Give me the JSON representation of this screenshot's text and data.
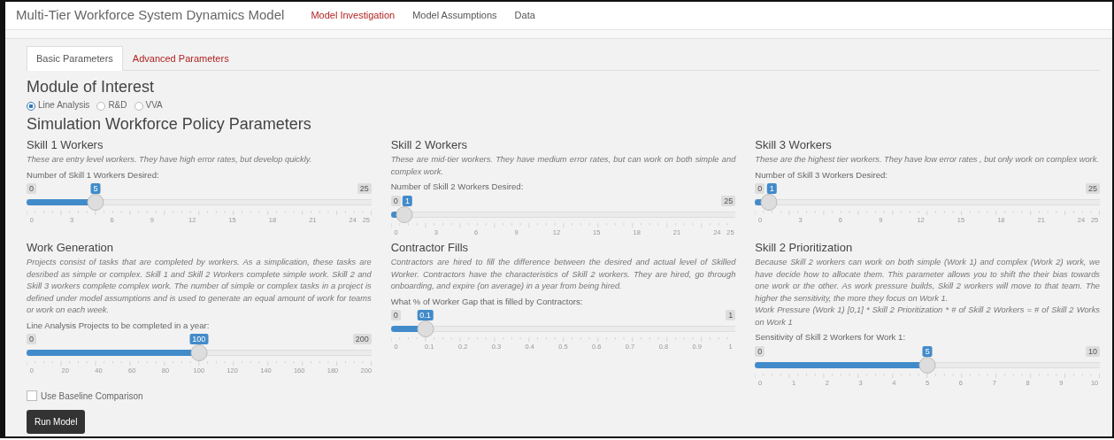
{
  "navbar": {
    "brand": "Multi-Tier Workforce System Dynamics Model",
    "items": [
      {
        "label": "Model Investigation",
        "selected": true
      },
      {
        "label": "Model Assumptions",
        "selected": false
      },
      {
        "label": "Data",
        "selected": false
      }
    ]
  },
  "tabs": [
    {
      "label": "Basic Parameters",
      "selected": true
    },
    {
      "label": "Advanced Parameters",
      "selected": false
    }
  ],
  "module": {
    "title": "Module of Interest",
    "options": [
      {
        "label": "Line Analysis",
        "selected": true
      },
      {
        "label": "R&D",
        "selected": false
      },
      {
        "label": "VVA",
        "selected": false
      }
    ]
  },
  "section_title": "Simulation Workforce Policy Parameters",
  "panels": [
    {
      "title": "Skill 1 Workers",
      "description": "These are entry level workers. They have high error rates, but develop quickly.",
      "slider": {
        "label": "Number of Skill 1 Workers Desired:",
        "min": "0",
        "max": "25",
        "value": "5",
        "level": 0.2,
        "ticks": [
          "0",
          "3",
          "6",
          "9",
          "12",
          "15",
          "18",
          "21",
          "24",
          "25"
        ]
      }
    },
    {
      "title": "Skill 2 Workers",
      "description": "These are mid-tier workers. They have medium error rates, but can work on both simple and complex work.",
      "slider": {
        "label": "Number of Skill 2 Workers Desired:",
        "min": "0",
        "max": "25",
        "value": "1",
        "level": 0.04,
        "ticks": [
          "0",
          "3",
          "6",
          "9",
          "12",
          "15",
          "18",
          "21",
          "24",
          "25"
        ]
      }
    },
    {
      "title": "Skill 3 Workers",
      "description": "These are the highest tier workers. They have low error rates , but only work on complex work.",
      "slider": {
        "label": "Number of Skill 3 Workers Desired:",
        "min": "0",
        "max": "25",
        "value": "1",
        "level": 0.04,
        "ticks": [
          "0",
          "3",
          "6",
          "9",
          "12",
          "15",
          "18",
          "21",
          "24",
          "25"
        ]
      }
    },
    {
      "title": "Work Generation",
      "description": "Projects consist of tasks that are completed by workers. As a simplication, these tasks are desribed as simple or complex. Skill 1 and Skill 2 Workers complete simple work. Skill 2 and Skill 3 workers complete complex work. The number of simple or complex tasks in a project is defined under model assumptions and is used to generate an equal amount of work for teams or work on each week.",
      "slider": {
        "label": "Line Analysis Projects to be completed in a year:",
        "min": "0",
        "max": "200",
        "value": "100",
        "level": 0.5,
        "ticks": [
          "0",
          "20",
          "40",
          "60",
          "80",
          "100",
          "120",
          "140",
          "160",
          "180",
          "200"
        ]
      }
    },
    {
      "title": "Contractor Fills",
      "description": "Contractors are hired to fill the difference between the desired and actual level of Skilled Worker. Contractors have the characteristics of Skill 2 workers. They are hired, go through onboarding, and expire (on average) in a year from being hired.",
      "slider": {
        "label": "What % of Worker Gap that is filled by Contractors:",
        "min": "0",
        "max": "1",
        "value": "0.1",
        "level": 0.1,
        "ticks": [
          "0",
          "0.1",
          "0.2",
          "0.3",
          "0.4",
          "0.5",
          "0.6",
          "0.7",
          "0.8",
          "0.9",
          "1"
        ]
      }
    },
    {
      "title": "Skill 2 Prioritization",
      "description": "Because Skill 2 workers can work on both simple (Work 1) and complex (Work 2) work, we have decide how to allocate them. This parameter allows you to shift the their bias towards one work or the other. As work pressure builds, Skill 2 workers will move to that team. The higher the sensitivity, the more they focus on Work 1.",
      "formula": "Work Pressure (Work 1) [0,1] * Skill 2 Prioritization * # of Skill 2 Workers = # of Skill 2 Works on Work 1",
      "slider": {
        "label": "Sensitivity of Skill 2 Workers for Work 1:",
        "min": "0",
        "max": "10",
        "value": "5",
        "level": 0.5,
        "ticks": [
          "0",
          "1",
          "2",
          "3",
          "4",
          "5",
          "6",
          "7",
          "8",
          "9",
          "10"
        ]
      }
    }
  ],
  "baseline": {
    "label": "Use Baseline Comparison",
    "checked": false
  },
  "run_button": "Run Model"
}
